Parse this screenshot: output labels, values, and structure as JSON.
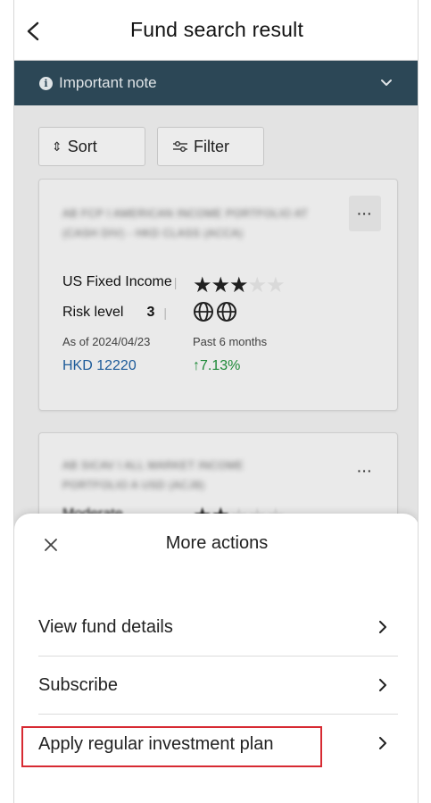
{
  "header": {
    "title": "Fund search result"
  },
  "note": {
    "label": "Important note"
  },
  "toolbar": {
    "sort_label": "Sort",
    "filter_label": "Filter"
  },
  "funds": [
    {
      "name_blurred": "AB FCP I AMERICAN INCOME PORTFOLIO AT (CASH DIV) - HKD CLASS (ACCA)",
      "category": "US Fixed Income",
      "rating": 3,
      "rating_max": 5,
      "risk_label": "Risk level",
      "risk_value": "3",
      "as_of": "As of 2024/04/23",
      "period": "Past 6 months",
      "price": "HKD 12220",
      "change": "↑7.13%"
    },
    {
      "name_blurred": "AB SICAV I ALL MARKET INCOME PORTFOLIO A USD (ACJ8)",
      "category_blurred": "Moderate",
      "rating": 2,
      "rating_max": 5
    }
  ],
  "sheet": {
    "title": "More actions",
    "items": [
      {
        "label": "View fund details"
      },
      {
        "label": "Subscribe"
      },
      {
        "label": "Apply regular investment plan"
      }
    ]
  },
  "colors": {
    "note_bar": "#2e4a5a",
    "price_blue": "#1f5fa0",
    "change_green": "#1f8f3a",
    "highlight_red": "#d72a32"
  },
  "icons": [
    "chevron-left-icon",
    "info-icon",
    "chevron-down-icon",
    "sort-icon",
    "filter-icon",
    "more-icon",
    "star-icon",
    "globe-icon",
    "close-icon",
    "chevron-right-icon"
  ]
}
